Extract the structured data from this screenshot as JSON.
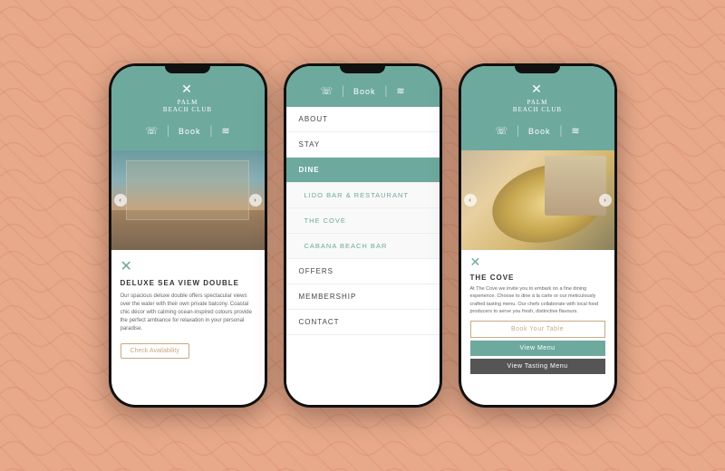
{
  "background": {
    "color": "#e8a98a"
  },
  "phone1": {
    "logo_text": "PALM",
    "logo_subtext": "BEACH CLUB",
    "nav": {
      "phone_icon": "📞",
      "book_label": "Book",
      "waves_icon": "≋"
    },
    "carousel": {
      "prev_label": "‹",
      "next_label": "›"
    },
    "section_icon": "✕",
    "room_title": "DELUXE SEA VIEW DOUBLE",
    "description": "Our spacious deluxe double offers spectacular views over the water with their own private balcony. Coastal chic décor with calming ocean-inspired colours provide the perfect ambiance for relaxation in your personal paradise.",
    "cta_label": "Check Availability"
  },
  "phone2": {
    "nav": {
      "phone_icon": "📞",
      "book_label": "Book",
      "waves_icon": "≋"
    },
    "menu_items": [
      {
        "label": "ABOUT",
        "type": "normal"
      },
      {
        "label": "STAY",
        "type": "normal"
      },
      {
        "label": "DINE",
        "type": "highlighted"
      },
      {
        "label": "LIDO BAR & RESTAURANT",
        "type": "sub"
      },
      {
        "label": "THE COVE",
        "type": "sub"
      },
      {
        "label": "CABANA BEACH BAR",
        "type": "sub"
      },
      {
        "label": "OFFERS",
        "type": "normal"
      },
      {
        "label": "MEMBERSHIP",
        "type": "normal"
      },
      {
        "label": "CONTACT",
        "type": "normal"
      }
    ]
  },
  "phone3": {
    "logo_text": "PALM",
    "logo_subtext": "BEACH CLUB",
    "nav": {
      "phone_icon": "📞",
      "book_label": "Book",
      "waves_icon": "≋"
    },
    "carousel": {
      "prev_label": "‹",
      "next_label": "›"
    },
    "section_icon": "✕",
    "title": "THE COVE",
    "description": "At The Cove we invite you to embark on a fine dining experience. Choose to dine à la carte or our meticulously crafted tasting menu. Our chefs collaborate with local food producers to serve you fresh, distinctive flavours.",
    "btn1_label": "Book Your Table",
    "btn2_label": "View Menu",
    "btn3_label": "View Tasting Menu"
  }
}
